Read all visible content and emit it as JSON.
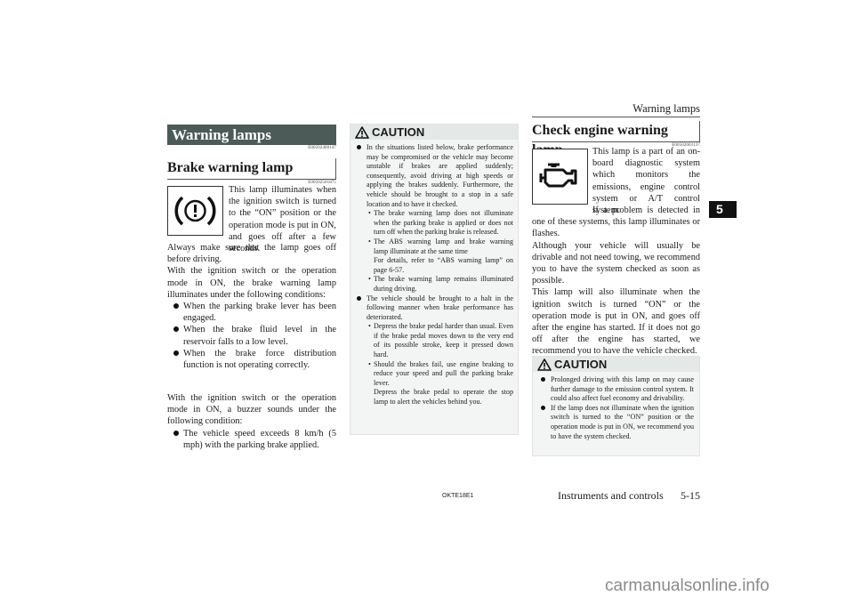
{
  "running_head": "Warning lamps",
  "chapter_tab": "5",
  "left_column": {
    "section_banner": "Warning lamps",
    "section_code": "E00502400147",
    "subsection_title": "Brake warning lamp",
    "subsection_code": "E00502501875",
    "lamp_icon": "brake-warning-icon",
    "intro": "This lamp illuminates when the ignition switch is turned to the “ON” position or the operation mode is put in ON, and goes off after a few seconds.",
    "p1": "Always make sure that the lamp goes off before driving.",
    "p2": "With the ignition switch or the operation mode in ON, the brake warning lamp illuminates under the following conditions:",
    "conditions": [
      "When the parking brake lever has been engaged.",
      "When the brake fluid level in the reservoir falls to a low level.",
      "When the brake force distribution function is not operating correctly."
    ],
    "p3": "With the ignition switch or the operation mode in ON, a buzzer sounds under the following condition:",
    "buzzer_conditions": [
      "The vehicle speed exceeds 8 km/h (5 mph) with the parking brake applied."
    ]
  },
  "middle_column": {
    "caution_label": "CAUTION",
    "caution_icon": "warning-triangle-icon",
    "bullet1": "In the situations listed below, brake performance may be compromised or the vehicle may become unstable if brakes are applied suddenly; consequently, avoid driving at high speeds or applying the brakes suddenly. Furthermore, the vehicle should be brought to a stop in a safe location and to have it checked.",
    "sub1": [
      {
        "text": "The brake warning lamp does not illuminate when the parking brake is applied or does not turn off when the parking brake is released."
      },
      {
        "text": "The ABS warning lamp and brake warning lamp illuminate at the same time",
        "note": "For details, refer to “ABS warning lamp” on page 6-57."
      },
      {
        "text": "The brake warning lamp remains illuminated during driving."
      }
    ],
    "bullet2": "The vehicle should be brought to a halt in the following manner when brake performance has deteriorated.",
    "sub2": [
      {
        "text": "Depress the brake pedal harder than usual. Even if the brake pedal moves down to the very end of its possible stroke, keep it pressed down hard."
      },
      {
        "text": "Should the brakes fail, use engine braking to reduce your speed and pull the parking brake lever.",
        "note": "Depress the brake pedal to operate the stop lamp to alert the vehicles behind you."
      }
    ]
  },
  "right_column": {
    "subsection_title": "Check engine warning lamp",
    "subsection_code": "E00502603137",
    "lamp_icon": "check-engine-icon",
    "intro": "This lamp is a part of an on-board diagnostic system which monitors the emissions, engine control system or A/T control system.",
    "intro2": "If a problem is detected in one of these systems, this lamp illuminates or flashes.",
    "p1": "Although your vehicle will usually be drivable and not need towing, we recommend you to have the system checked as soon as possible.",
    "p2": "This lamp will also illuminate when the ignition switch is turned “ON” or the operation mode is put in ON, and goes off after the engine has started. If it does not go off after the engine has started, we recommend you to have the vehicle checked.",
    "caution_label": "CAUTION",
    "caution_bullets": [
      "Prolonged driving with this lamp on may cause further damage to the emission control system. It could also affect fuel economy and drivability.",
      "If the lamp does not illuminate when the ignition switch is turned to the “ON” position or the operation mode is put in ON, we recommend you to have the system checked."
    ]
  },
  "footer": {
    "doc_code": "OKTE18E1",
    "section_name": "Instruments and controls",
    "page_number": "5-15"
  },
  "watermark": "carmanualsonline.info"
}
